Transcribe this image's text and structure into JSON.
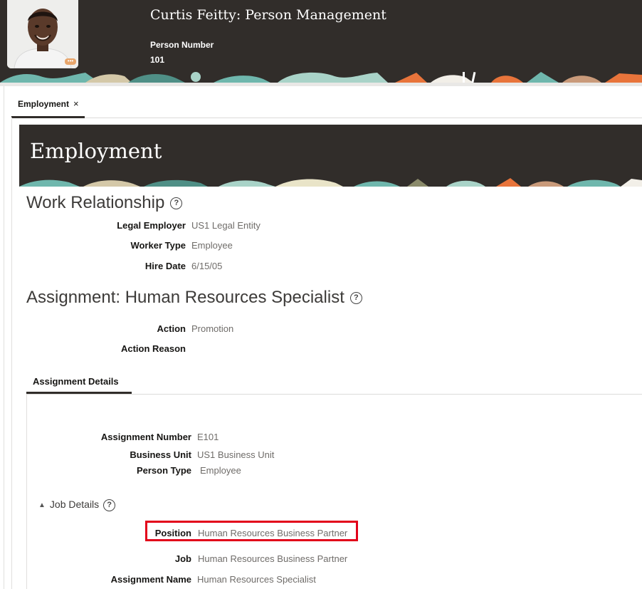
{
  "header": {
    "title": "Curtis Feitty: Person Management",
    "person_number_label": "Person Number",
    "person_number": "101",
    "avatar_badge": "•••"
  },
  "tabs": [
    {
      "label": "Employment",
      "close": "×"
    }
  ],
  "banner": {
    "title": "Employment"
  },
  "work_relationship": {
    "title": "Work Relationship",
    "help": "?",
    "fields": [
      {
        "label": "Legal Employer",
        "value": "US1 Legal Entity"
      },
      {
        "label": "Worker Type",
        "value": "Employee"
      },
      {
        "label": "Hire Date",
        "value": "6/15/05"
      }
    ]
  },
  "assignment": {
    "title": "Assignment: Human Resources Specialist",
    "help": "?",
    "fields": [
      {
        "label": "Action",
        "value": "Promotion"
      },
      {
        "label": "Action Reason",
        "value": ""
      }
    ]
  },
  "assignment_details": {
    "tab_label": "Assignment Details",
    "fields": [
      {
        "label": "Assignment Number",
        "value": "E101"
      },
      {
        "label": "Business Unit",
        "value": "US1 Business Unit"
      },
      {
        "label": "Person Type",
        "value": "Employee"
      }
    ],
    "job_details": {
      "title": "Job Details",
      "toggle_icon": "▲",
      "help": "?",
      "fields": [
        {
          "label": "Position",
          "value": "Human Resources Business Partner"
        },
        {
          "label": "Job",
          "value": "Human Resources Business Partner"
        },
        {
          "label": "Assignment Name",
          "value": "Human Resources Specialist"
        }
      ]
    }
  },
  "colors": {
    "header_bg": "#312d2a",
    "highlight_border": "#e2001a",
    "teal": "#6fb7ad",
    "orange": "#e8743b"
  }
}
